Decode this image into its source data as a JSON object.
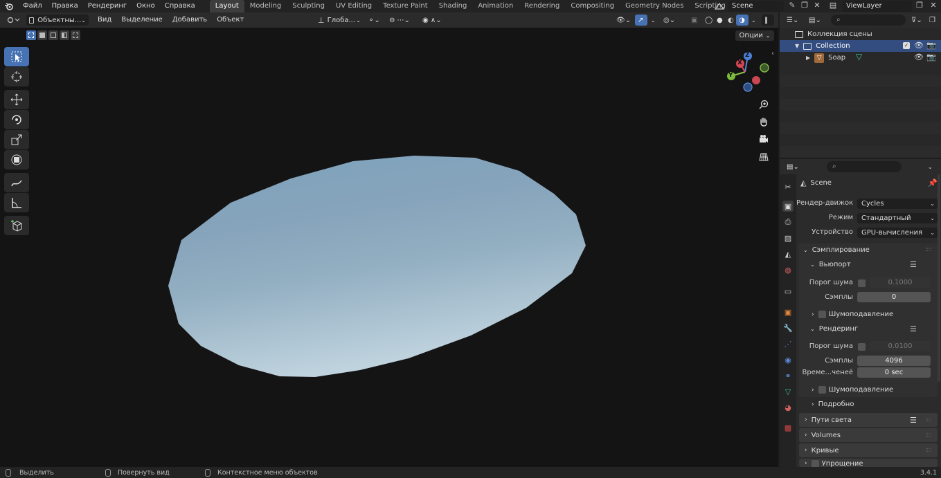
{
  "topbar": {
    "menus": [
      "Файл",
      "Правка",
      "Рендеринг",
      "Окно",
      "Справка"
    ],
    "workspaces": [
      "Layout",
      "Modeling",
      "Sculpting",
      "UV Editing",
      "Texture Paint",
      "Shading",
      "Animation",
      "Rendering",
      "Compositing",
      "Geometry Nodes",
      "Scripting"
    ],
    "active_workspace": "Layout",
    "add_tab": "+",
    "scene_name": "Scene",
    "view_layer": "ViewLayer"
  },
  "viewport_header": {
    "mode": "Объектны...",
    "menus": [
      "Вид",
      "Выделение",
      "Добавить",
      "Объект"
    ],
    "orientation": "Глоба...",
    "options": "Опции"
  },
  "viewport": {
    "object_color": "#8fb0c6",
    "gizmo": {
      "x_label": "X",
      "y_label": "Y",
      "z_label": "Z"
    }
  },
  "outliner": {
    "root": "Коллекция сцены",
    "collection": "Collection",
    "object": "Soap"
  },
  "properties": {
    "scene_label": "Scene",
    "render_engine_label": "Рендер-движок",
    "render_engine": "Cycles",
    "mode_label": "Режим",
    "mode": "Стандартный",
    "device_label": "Устройство",
    "device": "GPU-вычисления",
    "sampling": "Сэмплирование",
    "viewport": "Вьюпорт",
    "noise_threshold_label": "Порог шума",
    "vp_noise_threshold": "0.1000",
    "samples_label": "Сэмплы",
    "vp_samples": "0",
    "denoise_label": "Шумоподавление",
    "render": "Рендеринг",
    "r_noise_threshold": "0.0100",
    "r_samples": "4096",
    "time_limit_label": "Време...ченеё",
    "time_limit": "0 sec",
    "details": "Подробно",
    "light_paths": "Пути света",
    "volumes": "Volumes",
    "curves": "Кривые",
    "simplify": "Упрощение"
  },
  "statusbar": {
    "select": "Выделить",
    "rotate_view": "Повернуть вид",
    "context_menu": "Контекстное меню объектов",
    "version": "3.4.1"
  }
}
